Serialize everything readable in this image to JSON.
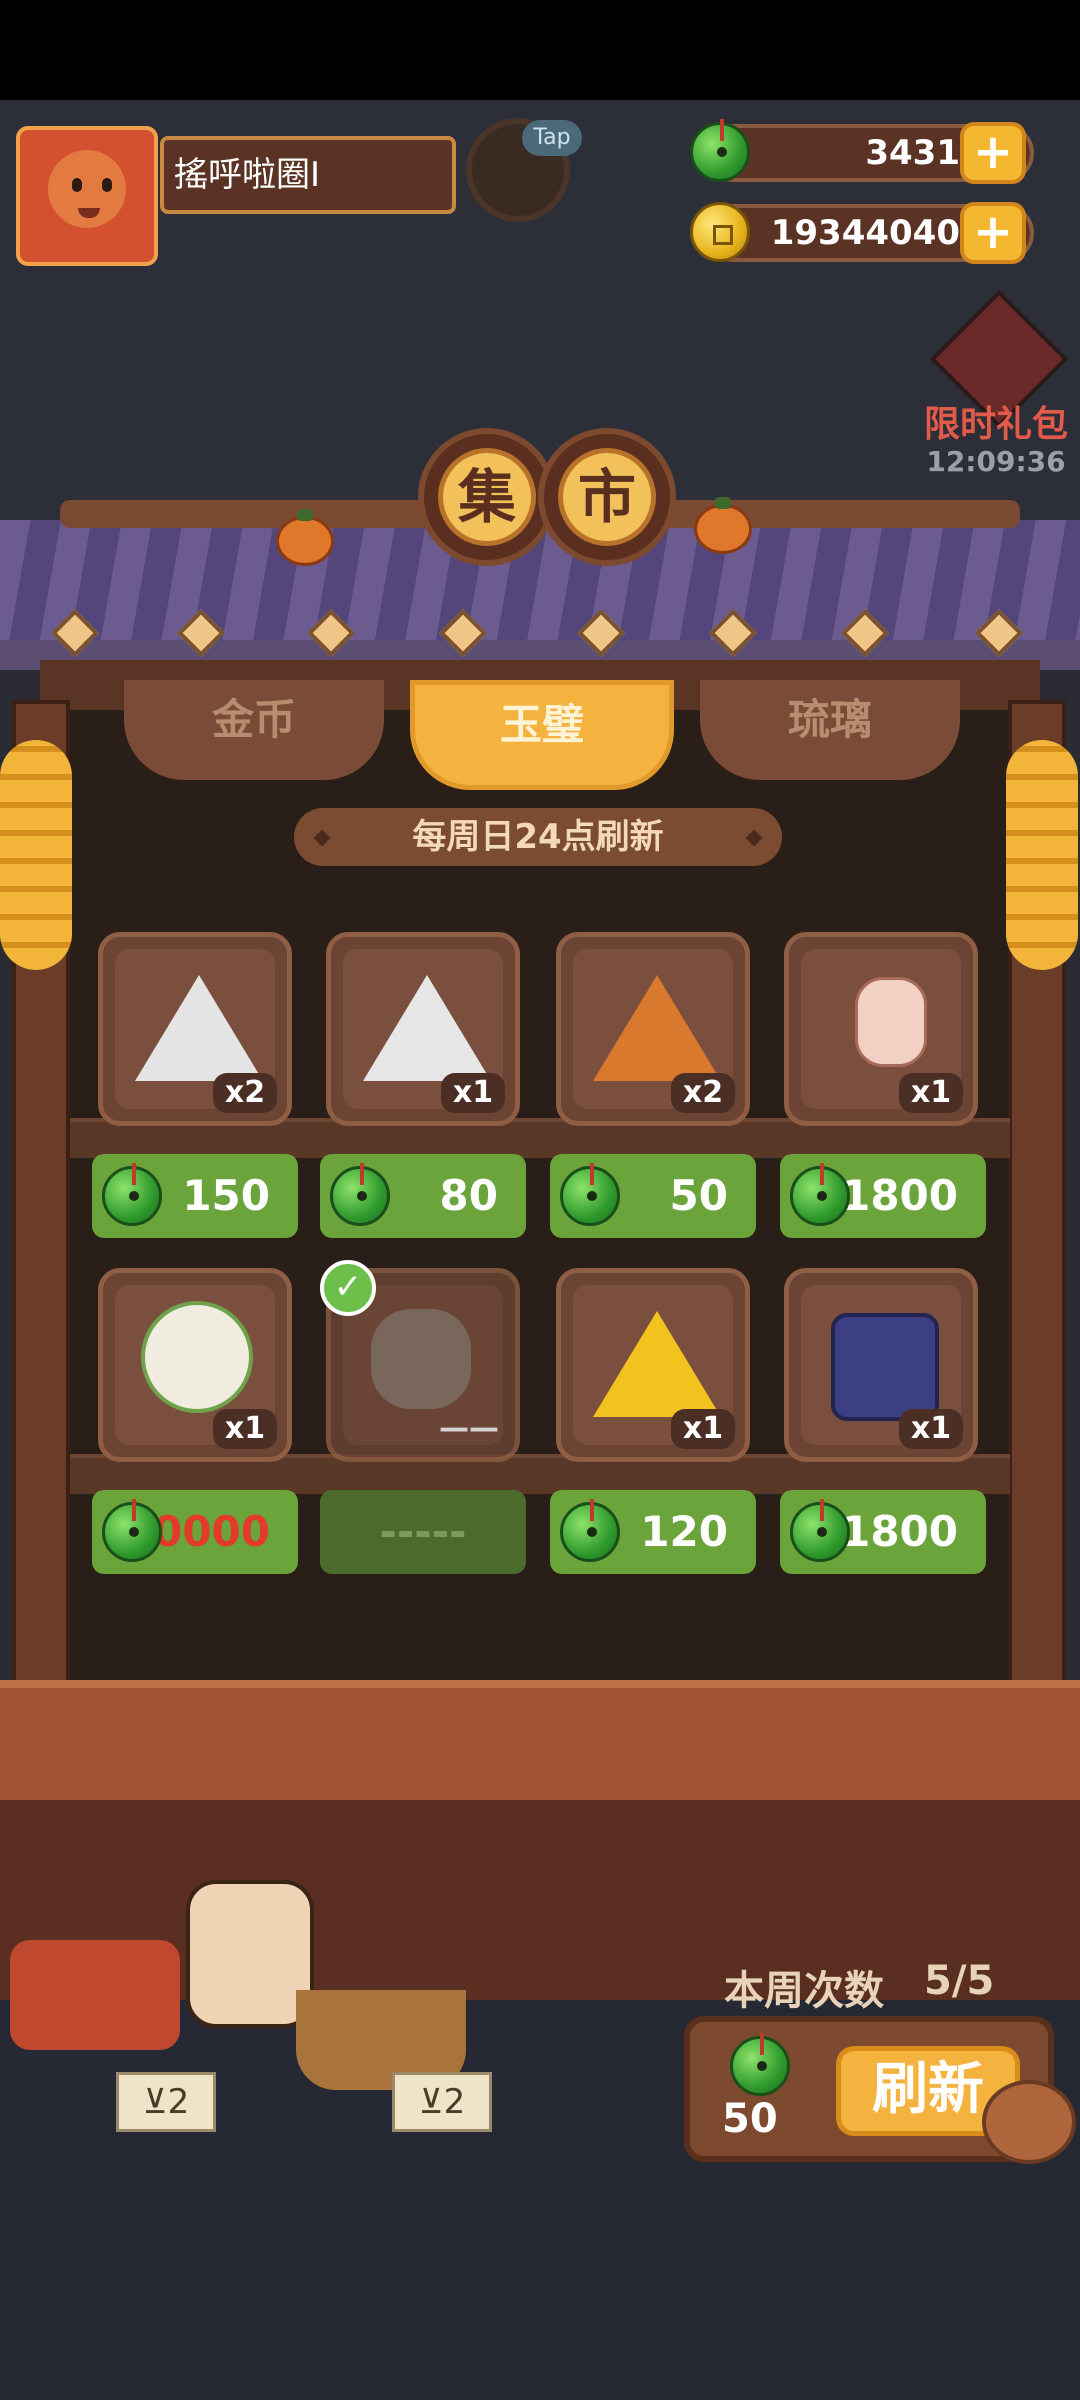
{
  "player": {
    "name": "搖呼啦圈I"
  },
  "tap_badge": "Tap",
  "currencies": {
    "jade": "3431",
    "gold": "19344040"
  },
  "limited_gift": {
    "title": "限时礼包",
    "timer": "12:09:36"
  },
  "market_title": [
    "集",
    "市"
  ],
  "tabs": [
    {
      "label": "金币",
      "active": false
    },
    {
      "label": "玉璧",
      "active": true
    },
    {
      "label": "琉璃",
      "active": false
    }
  ],
  "refresh_note": "每周日24点刷新",
  "items_row1": [
    {
      "icon": "silver-spiral-triangle-icon",
      "qty": "x2",
      "price": "150"
    },
    {
      "icon": "silver-leaf-triangle-icon",
      "qty": "x1",
      "price": "80"
    },
    {
      "icon": "orange-rune-triangle-icon",
      "qty": "x2",
      "price": "50"
    },
    {
      "icon": "lotus-lantern-icon",
      "qty": "x1",
      "price": "1800"
    }
  ],
  "items_row2": [
    {
      "icon": "green-hair-girl-icon",
      "qty": "x1",
      "price": "30000",
      "price_color": "red"
    },
    {
      "icon": "musician-bear-icon",
      "qty": "——",
      "price": "-----",
      "purchased": true
    },
    {
      "icon": "gold-fish-triangle-icon",
      "qty": "x1",
      "price": "120"
    },
    {
      "icon": "blue-cake-icon",
      "qty": "x1",
      "price": "1800"
    }
  ],
  "weekly": {
    "label": "本周次数",
    "count": "5/5"
  },
  "refresh": {
    "label": "刷新",
    "cost": "50"
  },
  "signs": [
    "⊻2",
    "⊻2"
  ],
  "colors": {
    "accent": "#f4b23e",
    "jade_green": "#6aa43a",
    "wood": "#6b4434",
    "red_price": "#e23b2a"
  }
}
